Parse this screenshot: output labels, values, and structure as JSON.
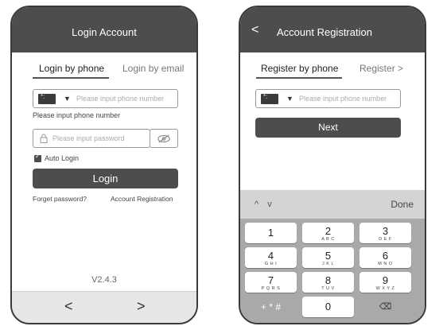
{
  "login": {
    "title": "Login Account",
    "tab_phone": "Login by phone",
    "tab_email": "Login by email",
    "phone_placeholder": "Please input phone number",
    "phone_hint": "Please input phone number",
    "password_placeholder": "Please input password",
    "auto_login": "Auto Login",
    "login_button": "Login",
    "forget_password": "Forget password?",
    "account_registration": "Account Registration",
    "version": "V2.4.3",
    "nav_back": "<",
    "nav_forward": ">"
  },
  "register": {
    "back": "<",
    "title": "Account Registration",
    "tab_phone": "Register by phone",
    "tab_other": "Register >",
    "phone_placeholder": "Please input phone number",
    "next_button": "Next"
  },
  "keyboard": {
    "arrows": "^ v",
    "done": "Done",
    "keys": [
      {
        "num": "1",
        "letters": ""
      },
      {
        "num": "2",
        "letters": "A B C"
      },
      {
        "num": "3",
        "letters": "D E F"
      },
      {
        "num": "4",
        "letters": "G H I"
      },
      {
        "num": "5",
        "letters": "J K L"
      },
      {
        "num": "6",
        "letters": "M N O"
      },
      {
        "num": "7",
        "letters": "P Q R S"
      },
      {
        "num": "8",
        "letters": "T U V"
      },
      {
        "num": "9",
        "letters": "W X Y Z"
      },
      {
        "num": "+ * #",
        "letters": ""
      },
      {
        "num": "0",
        "letters": ""
      },
      {
        "num": "⌫",
        "letters": ""
      }
    ]
  },
  "colors": {
    "titlebar": "#4d4d4d",
    "button": "#4d4d4d",
    "keyboard_bg": "#a9a9a9",
    "navbar_bg": "#e6e6e6"
  },
  "icons": {
    "flag": "flag-icon",
    "caret": "caret-down-icon",
    "lock": "lock-icon",
    "eye": "eye-off-icon",
    "backspace": "backspace-icon"
  }
}
